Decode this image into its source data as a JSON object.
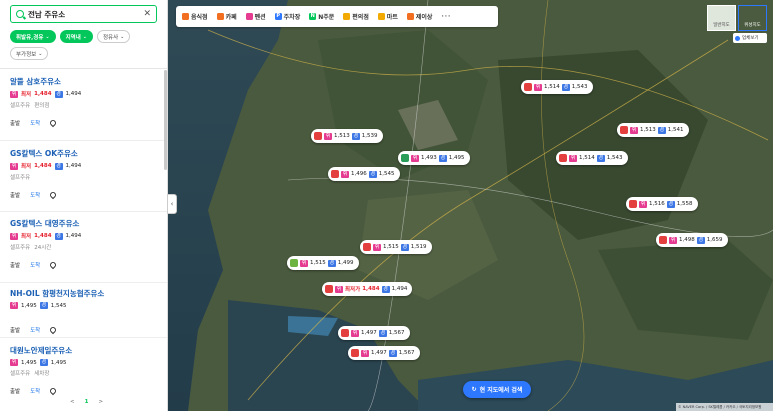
{
  "search": {
    "query": "전남 주유소"
  },
  "filters": [
    {
      "label": "휘발유,경유",
      "active": true
    },
    {
      "label": "지역내",
      "active": true
    },
    {
      "label": "정유사",
      "active": false
    },
    {
      "label": "부가정보",
      "active": false
    }
  ],
  "list": [
    {
      "name": "알뜰 삼호주유소",
      "lowest_label": "최저",
      "gasoline": "1,484",
      "diesel": "1,494",
      "meta": [
        "셀프주유",
        "편의점"
      ],
      "depart": "출발",
      "arrive": "도착"
    },
    {
      "name": "GS칼텍스 OK주유소",
      "lowest_label": "최저",
      "gasoline": "1,484",
      "diesel": "1,494",
      "meta": [
        "셀프주유"
      ],
      "depart": "출발",
      "arrive": "도착"
    },
    {
      "name": "GS칼텍스 대영주유소",
      "lowest_label": "최저",
      "gasoline": "1,484",
      "diesel": "1,494",
      "meta": [
        "셀프주유",
        "24시간"
      ],
      "depart": "출발",
      "arrive": "도착"
    },
    {
      "name": "NH-OIL 함평천지농협주유소",
      "lowest_label": "",
      "gasoline": "1,495",
      "diesel": "1,545",
      "meta": [],
      "depart": "출발",
      "arrive": "도착"
    },
    {
      "name": "대원노안제일주유소",
      "lowest_label": "",
      "gasoline": "1,495",
      "diesel": "1,495",
      "meta": [
        "셀프주유",
        "세차장"
      ],
      "depart": "출발",
      "arrive": "도착"
    }
  ],
  "pager": {
    "prev": "<",
    "current": "1",
    "next": ">"
  },
  "categories": [
    {
      "label": "음식점",
      "icon": "fork-knife-icon",
      "color": "#f26f21"
    },
    {
      "label": "카페",
      "icon": "cup-icon",
      "color": "#f26f21"
    },
    {
      "label": "펜션",
      "icon": "bed-icon",
      "color": "#e53c91"
    },
    {
      "label": "주차장",
      "icon": "parking-icon",
      "color": "#2e78ff"
    },
    {
      "label": "N주문",
      "icon": "n-order-icon",
      "color": "#03c75a"
    },
    {
      "label": "편의점",
      "icon": "store-icon",
      "color": "#f2a900"
    },
    {
      "label": "마트",
      "icon": "cart-icon",
      "color": "#f2a900"
    },
    {
      "label": "제이상",
      "icon": "pin-icon",
      "color": "#f26f21"
    }
  ],
  "more_label": "···",
  "map_type": {
    "normal": "일반지도",
    "satellite": "위성지도"
  },
  "biz_button": "업체보기",
  "markers": [
    {
      "brand": "sk",
      "gasoline": "1,514",
      "diesel": "1,543"
    },
    {
      "brand": "sk",
      "gasoline": "1,513",
      "diesel": "1,539"
    },
    {
      "brand": "sk",
      "gasoline": "1,513",
      "diesel": "1,541"
    },
    {
      "brand": "gs",
      "gasoline": "1,493",
      "diesel": "1,495"
    },
    {
      "brand": "sk",
      "gasoline": "1,514",
      "diesel": "1,543"
    },
    {
      "brand": "sk",
      "gasoline": "1,496",
      "diesel": "1,545"
    },
    {
      "brand": "sk",
      "gasoline": "1,516",
      "diesel": "1,558"
    },
    {
      "brand": "sk",
      "gasoline": "1,515",
      "diesel": "1,519"
    },
    {
      "brand": "s-oil",
      "gasoline": "1,498",
      "diesel": "1,659"
    },
    {
      "brand": "nh",
      "gasoline": "1,515",
      "diesel": "1,499"
    },
    {
      "brand": "sk",
      "lowest_label": "최저가",
      "gasoline": "1,484",
      "diesel": "1,494"
    },
    {
      "brand": "sk",
      "gasoline": "1,497",
      "diesel": "1,567"
    },
    {
      "brand": "sk",
      "gasoline": "1,497",
      "diesel": "1,567"
    }
  ],
  "tag_labels": {
    "gasoline": "휘",
    "diesel": "경"
  },
  "research_button": "현 지도에서 검색",
  "credits": "© NAVER Corp. / SK텔레콤 / 카카오 / 국토지리정보원"
}
